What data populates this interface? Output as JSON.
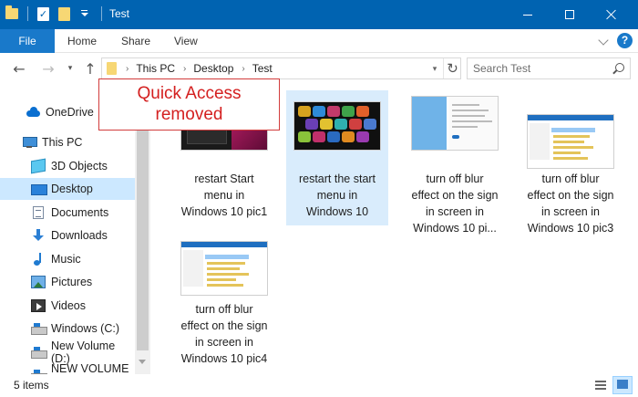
{
  "titlebar": {
    "title": "Test",
    "accent_color": "#0063b1"
  },
  "ribbon": {
    "file_tab": "File",
    "tabs": [
      "Home",
      "Share",
      "View"
    ]
  },
  "address": {
    "crumbs": [
      "This PC",
      "Desktop",
      "Test"
    ],
    "search_placeholder": "Search Test"
  },
  "navpane": {
    "items": [
      {
        "label": "OneDrive",
        "icon": "onedrive-cloud-icon"
      },
      {
        "label": "This PC",
        "icon": "computer-icon"
      },
      {
        "label": "3D Objects",
        "icon": "3d-objects-icon"
      },
      {
        "label": "Desktop",
        "icon": "desktop-icon",
        "selected": true
      },
      {
        "label": "Documents",
        "icon": "documents-icon"
      },
      {
        "label": "Downloads",
        "icon": "downloads-icon"
      },
      {
        "label": "Music",
        "icon": "music-icon"
      },
      {
        "label": "Pictures",
        "icon": "pictures-icon"
      },
      {
        "label": "Videos",
        "icon": "videos-icon"
      },
      {
        "label": "Windows (C:)",
        "icon": "drive-icon"
      },
      {
        "label": "New Volume (D:)",
        "icon": "drive-icon"
      },
      {
        "label": "NEW VOLUME (E",
        "icon": "drive-icon"
      }
    ]
  },
  "annotation": {
    "line1": "Quick Access",
    "line2": "removed",
    "color": "#d42020"
  },
  "files": [
    {
      "line1": "restart Start",
      "line2": "menu in",
      "line3": "Windows 10 pic1",
      "line4": ""
    },
    {
      "line1": "restart the start",
      "line2": "menu in",
      "line3": "Windows 10",
      "line4": "",
      "selected": true
    },
    {
      "line1": "turn off blur",
      "line2": "effect on the sign",
      "line3": "in screen in",
      "line4": "Windows 10 pi..."
    },
    {
      "line1": "turn off blur",
      "line2": "effect on the sign",
      "line3": "in screen in",
      "line4": "Windows 10 pic3"
    },
    {
      "line1": "turn off blur",
      "line2": "effect on the sign",
      "line3": "in screen in",
      "line4": "Windows 10 pic4"
    }
  ],
  "status": {
    "count": "5 items"
  }
}
